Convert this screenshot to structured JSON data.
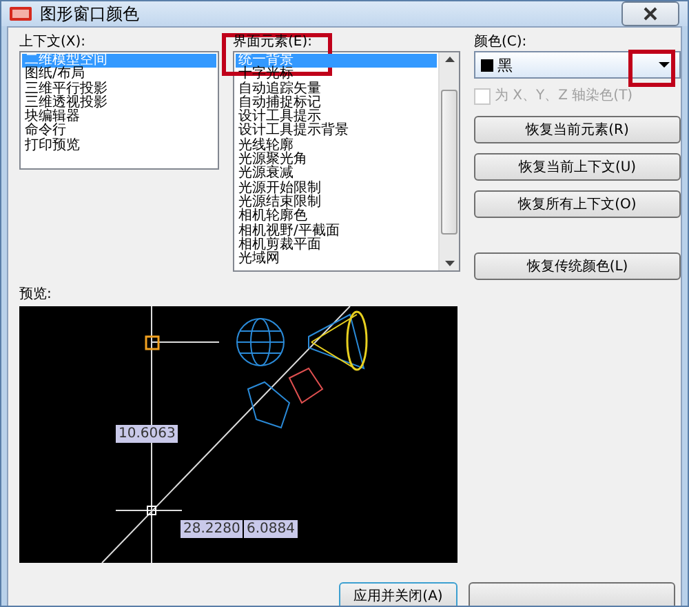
{
  "window": {
    "title": "图形窗口颜色"
  },
  "context": {
    "label": "上下文(X):",
    "items": [
      {
        "text": "二维模型空间",
        "selected": true
      },
      {
        "text": "图纸/布局",
        "selected": false
      },
      {
        "text": "三维平行投影",
        "selected": false
      },
      {
        "text": "三维透视投影",
        "selected": false
      },
      {
        "text": "块编辑器",
        "selected": false
      },
      {
        "text": "命令行",
        "selected": false
      },
      {
        "text": "打印预览",
        "selected": false
      }
    ]
  },
  "elements": {
    "label": "界面元素(E):",
    "items": [
      {
        "text": "统一背景",
        "selected": true
      },
      {
        "text": "十字光标",
        "selected": false
      },
      {
        "text": "自动追踪矢量",
        "selected": false
      },
      {
        "text": "自动捕捉标记",
        "selected": false
      },
      {
        "text": "设计工具提示",
        "selected": false
      },
      {
        "text": "设计工具提示背景",
        "selected": false
      },
      {
        "text": "光线轮廓",
        "selected": false
      },
      {
        "text": "光源聚光角",
        "selected": false
      },
      {
        "text": "光源衰减",
        "selected": false
      },
      {
        "text": "光源开始限制",
        "selected": false
      },
      {
        "text": "光源结束限制",
        "selected": false
      },
      {
        "text": "相机轮廓色",
        "selected": false
      },
      {
        "text": "相机视野/平截面",
        "selected": false
      },
      {
        "text": "相机剪裁平面",
        "selected": false
      },
      {
        "text": "光域网",
        "selected": false
      }
    ]
  },
  "color": {
    "label": "颜色(C):",
    "value": "黑"
  },
  "tint_checkbox": {
    "label": "为 X、Y、Z 轴染色(T)",
    "checked": false,
    "disabled": true
  },
  "buttons": [
    "恢复当前元素(R)",
    "恢复当前上下文(U)",
    "恢复所有上下文(O)",
    "恢复传统颜色(L)"
  ],
  "preview": {
    "label": "预览:",
    "readings": [
      "10.6063",
      "28.2280",
      "6.0884"
    ]
  },
  "footer_buttons": [
    "应用并关闭(A)"
  ]
}
